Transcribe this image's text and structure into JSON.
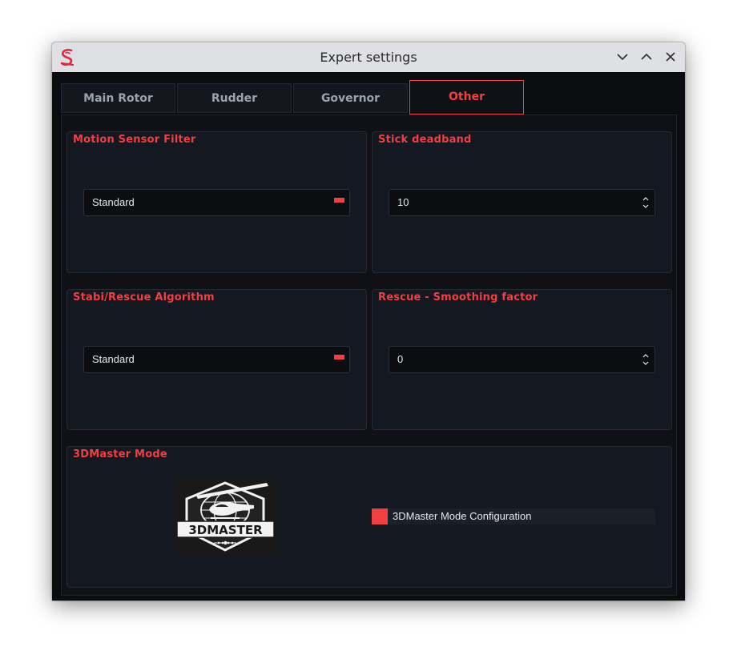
{
  "window": {
    "title": "Expert settings",
    "app_icon": "spirit-s-logo-icon"
  },
  "tabs": [
    {
      "label": "Main Rotor",
      "active": false
    },
    {
      "label": "Rudder",
      "active": false
    },
    {
      "label": "Governor",
      "active": false
    },
    {
      "label": "Other",
      "active": true
    }
  ],
  "groups": {
    "motion_filter": {
      "title": "Motion Sensor Filter",
      "value": "Standard"
    },
    "stick_deadband": {
      "title": "Stick deadband",
      "value": "10"
    },
    "stabi_algorithm": {
      "title": "Stabi/Rescue Algorithm",
      "value": "Standard"
    },
    "rescue_smoothing": {
      "title": "Rescue - Smoothing factor",
      "value": "0"
    },
    "master_mode": {
      "title": "3DMaster Mode",
      "logo_text": "3DMASTER",
      "checkbox_label": "3DMaster Mode Configuration"
    }
  },
  "colors": {
    "accent": "#f23f42",
    "window_bg": "#0b0c10",
    "panel_bg": "#141820",
    "titlebar_bg": "#dfe0e3"
  }
}
